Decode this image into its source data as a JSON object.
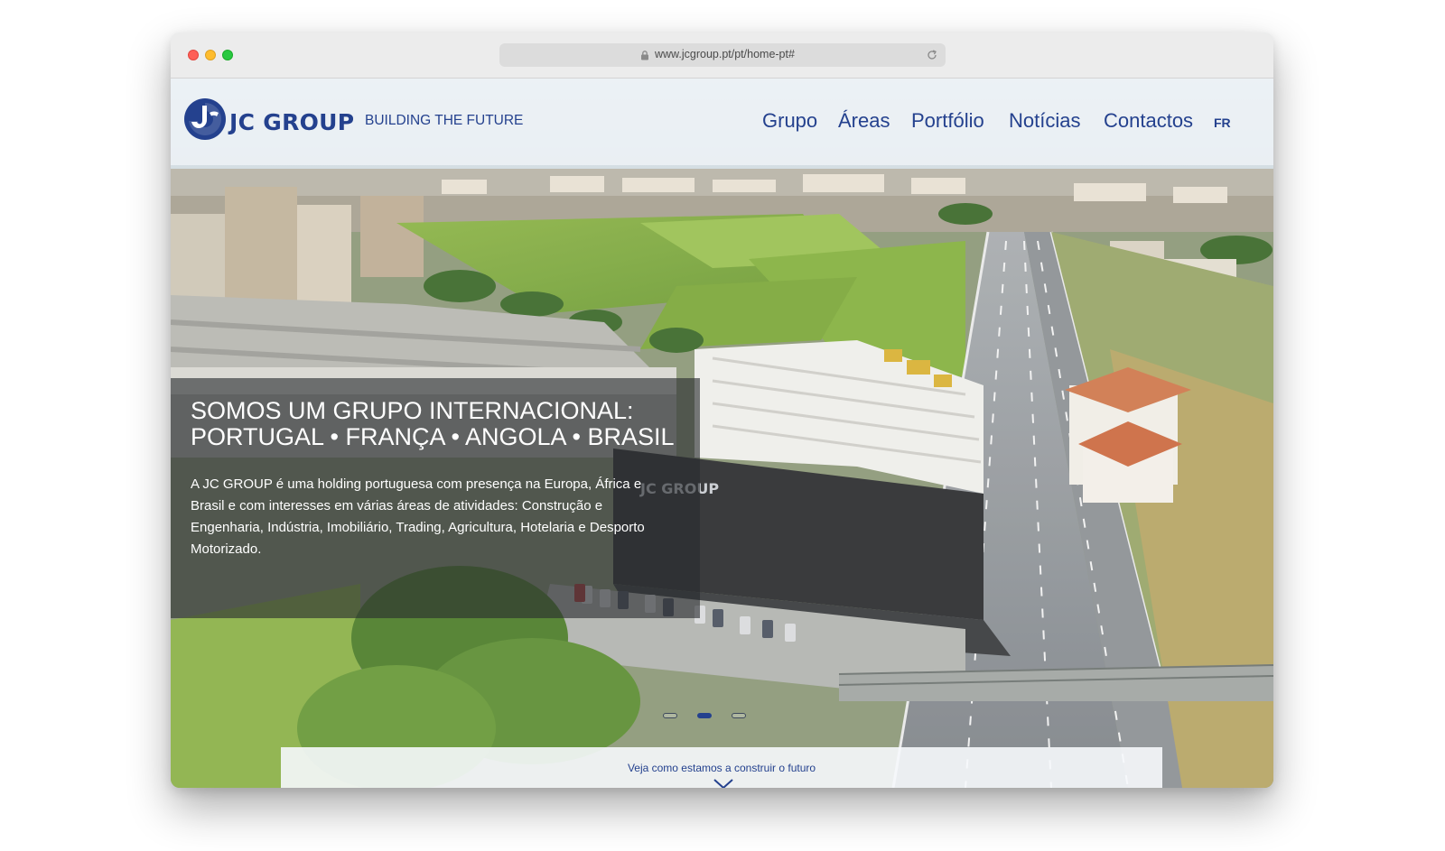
{
  "browser": {
    "url": "www.jcgroup.pt/pt/home-pt#",
    "icons": {
      "lock": "lock-icon",
      "reload": "reload-icon"
    }
  },
  "header": {
    "logo_text": "JC GROUP",
    "tagline": "BUILDING THE FUTURE",
    "nav": [
      "Grupo",
      "Áreas",
      "Portfólio",
      "Notícias",
      "Contactos"
    ],
    "lang": "FR"
  },
  "hero": {
    "headline_line1": "SOMOS UM GRUPO INTERNACIONAL:",
    "headline_line2": "PORTUGAL • FRANÇA • ANGOLA • BRASIL",
    "body_lines": [
      "A JC GROUP é uma holding portuguesa com presença na Europa, África e",
      "Brasil e com interesses em várias áreas de atividades: Construção e",
      "Engenharia, Indústria, Imobiliário, Trading, Agricultura, Hotelaria e Desporto",
      "Motorizado."
    ],
    "building_sign": "JC GROUP"
  },
  "slider": {
    "total": 3,
    "active_index": 2
  },
  "cta": {
    "text": "Veja como estamos a construir o futuro",
    "icon": "chevron-down-icon"
  },
  "colors": {
    "brand": "#24418e",
    "panel_overlay": "#282c2e"
  }
}
